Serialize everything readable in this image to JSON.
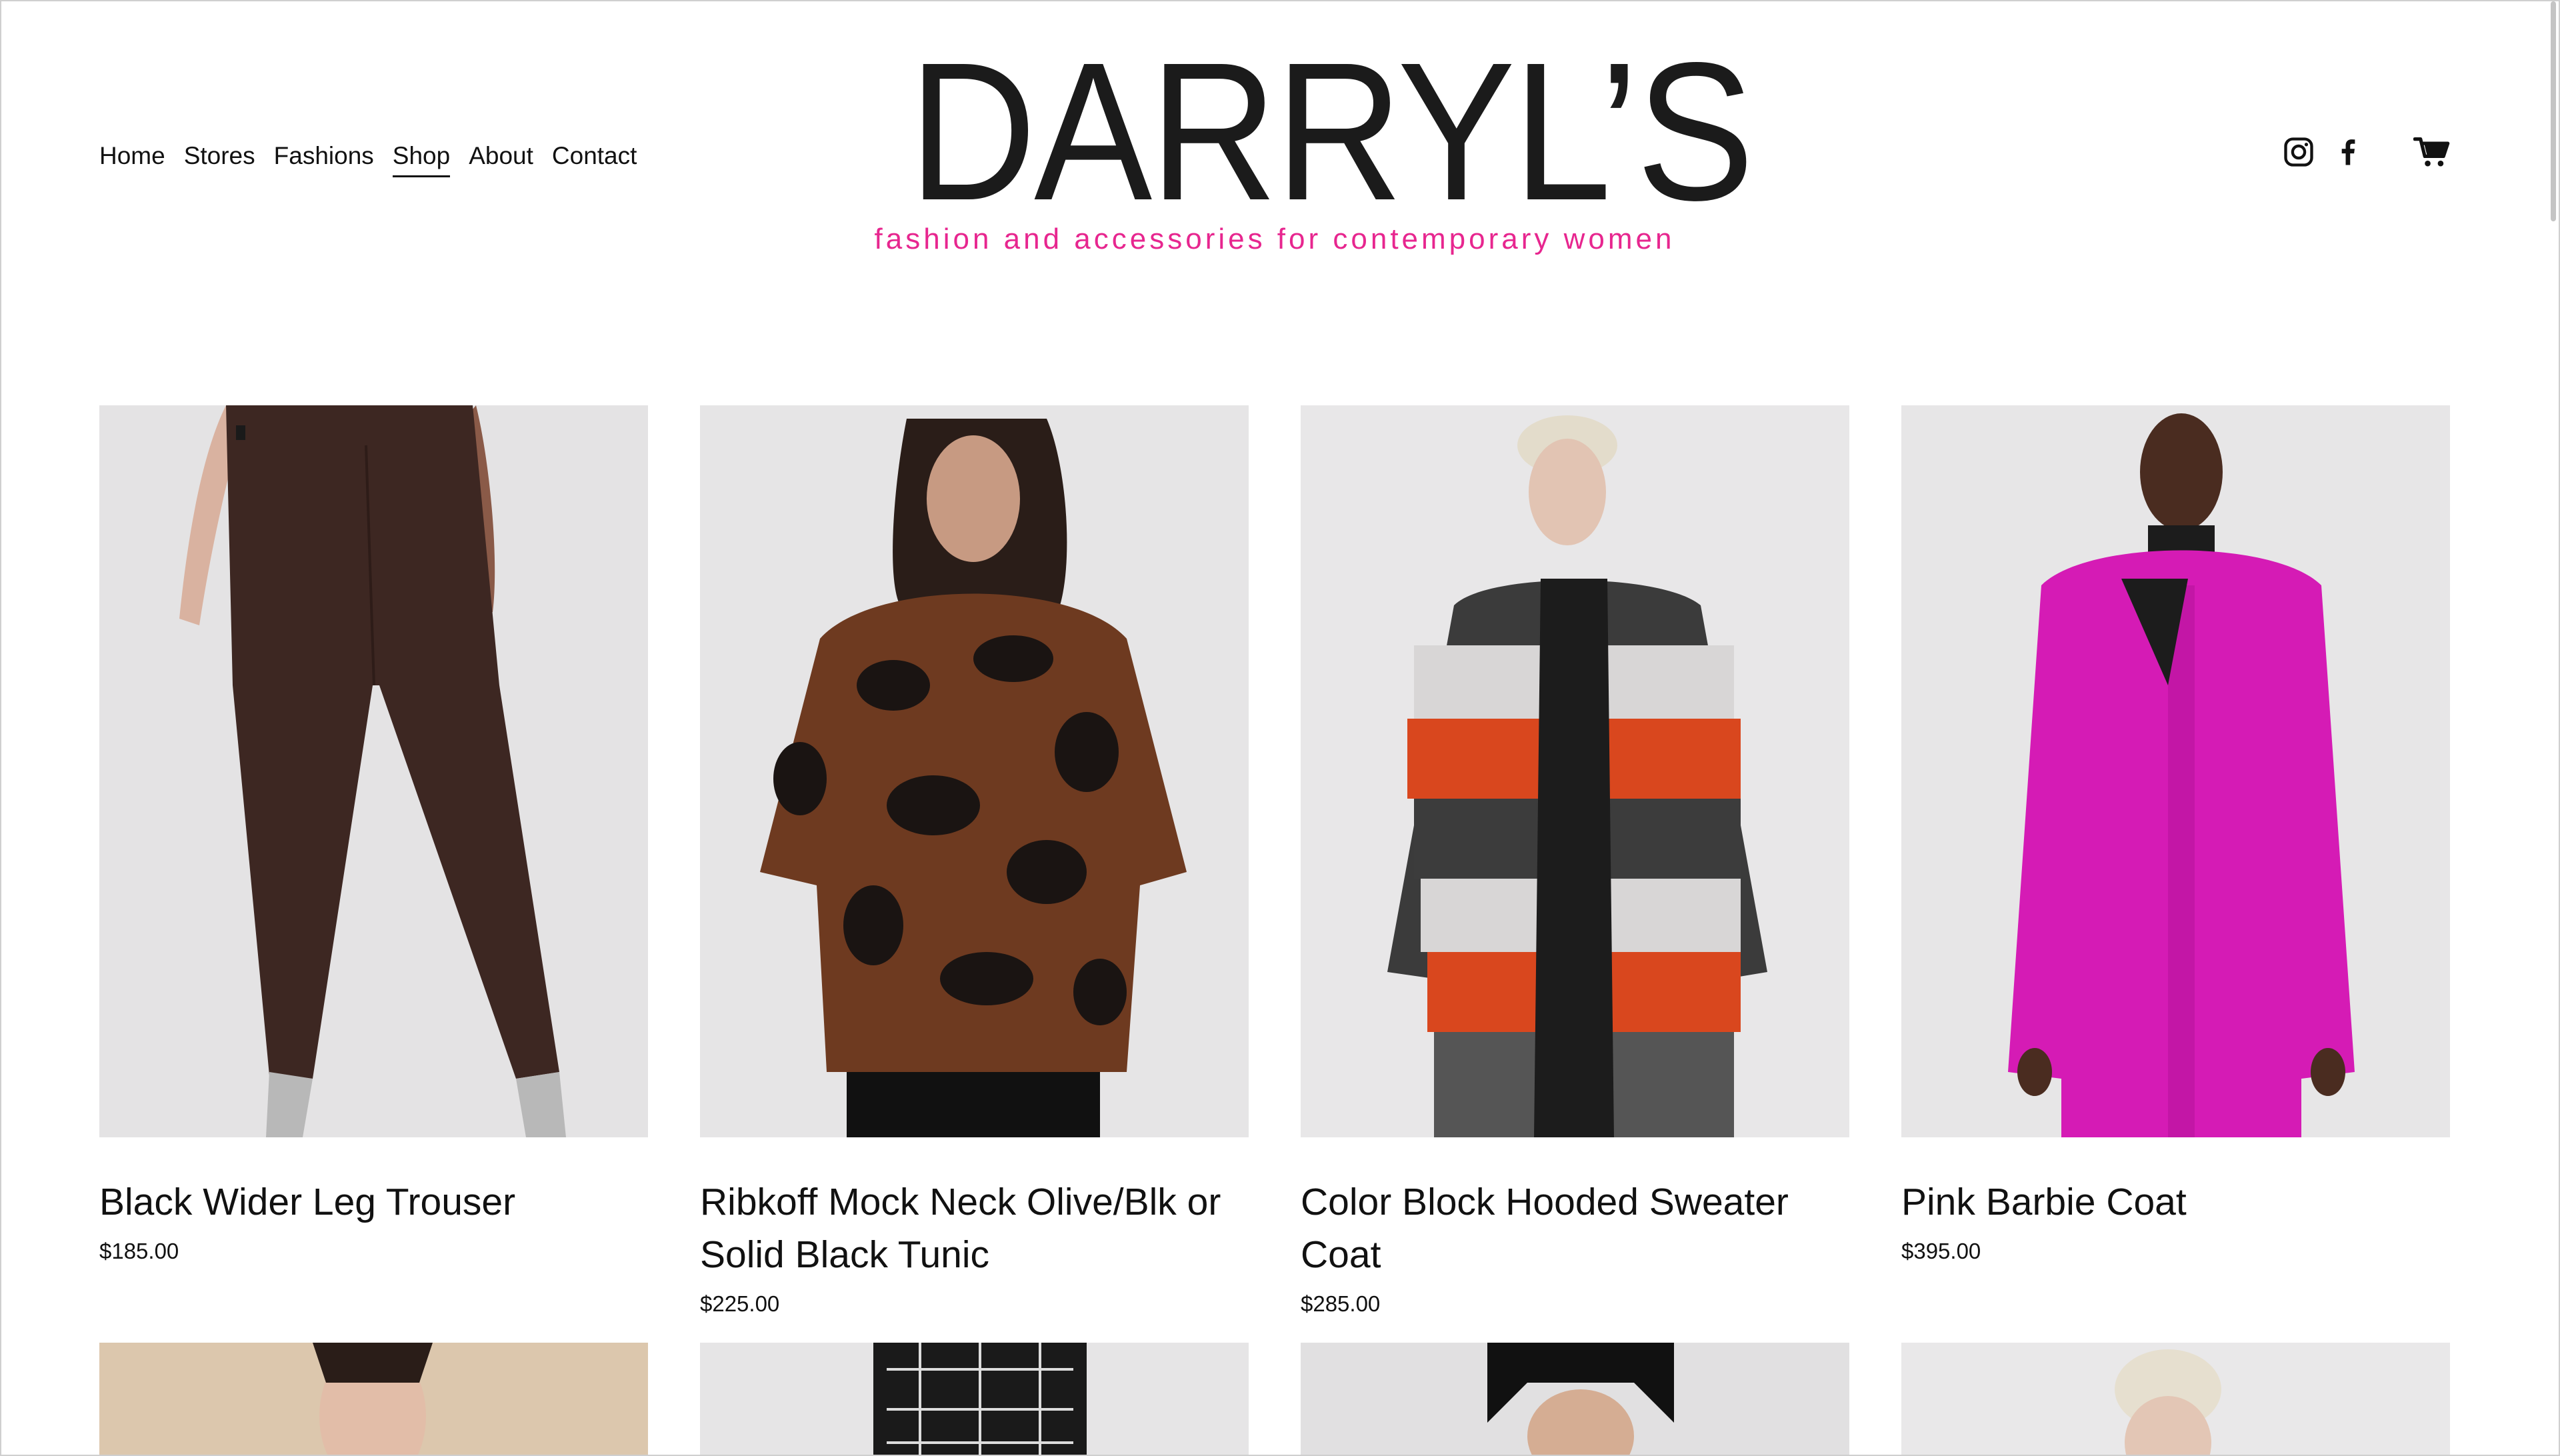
{
  "nav": {
    "items": [
      {
        "label": "Home"
      },
      {
        "label": "Stores"
      },
      {
        "label": "Fashions"
      },
      {
        "label": "Shop"
      },
      {
        "label": "About"
      },
      {
        "label": "Contact"
      }
    ],
    "active": "Shop"
  },
  "brand": {
    "logo": "DARRYL’S",
    "tagline": "fashion and accessories for contemporary women",
    "tagline_color": "#e7268f"
  },
  "header_icons": [
    "instagram-icon",
    "facebook-icon",
    "cart-icon"
  ],
  "products": [
    {
      "title": "Black Wider Leg Trouser",
      "price": "$185.00",
      "image": "product-photo-trouser"
    },
    {
      "title": "Ribkoff Mock Neck Olive/Blk or Solid Black Tunic",
      "price": "$225.00",
      "image": "product-photo-tunic"
    },
    {
      "title": "Color Block Hooded Sweater Coat",
      "price": "$285.00",
      "image": "product-photo-sweater-coat"
    },
    {
      "title": "Pink Barbie Coat",
      "price": "$395.00",
      "image": "product-photo-pink-coat"
    }
  ],
  "colors": {
    "accent_pink": "#e7268f",
    "text": "#111111",
    "image_bg": "#e6e5e6"
  }
}
